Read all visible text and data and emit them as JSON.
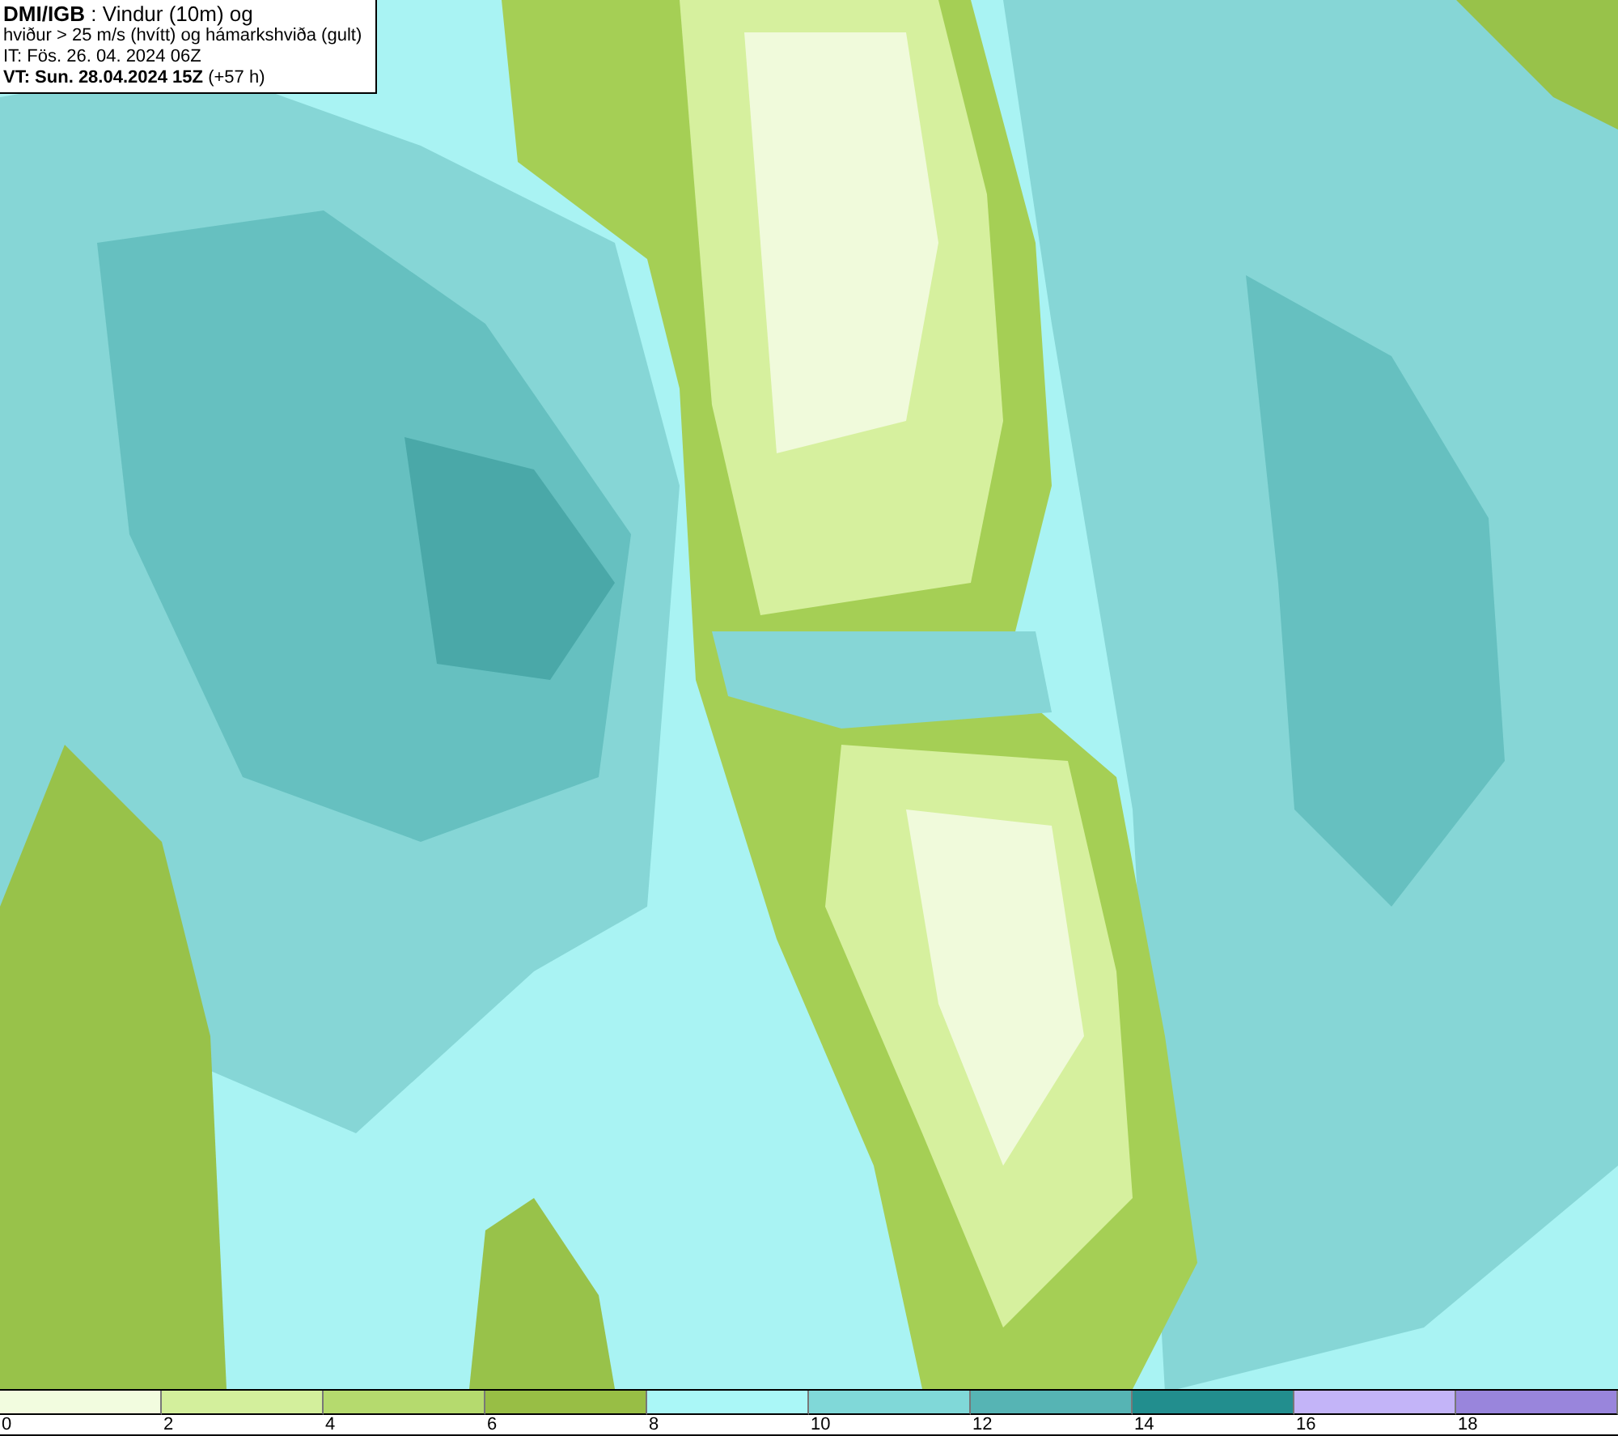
{
  "header": {
    "lines": [
      "**DMI/IGB** : Vindur (10m) og",
      "hviður > 25 m/s (hvítt) og hámarkshviða (gult)",
      "IT: Fös. 26. 04. 2024 06Z",
      "**VT: Sun. 28.04.2024 15Z** (+57 h)"
    ]
  },
  "legend": {
    "bins": [
      {
        "color": "#f2fcdf",
        "label": "0"
      },
      {
        "color": "#d3ef9c",
        "label": "2"
      },
      {
        "color": "#b5da6e",
        "label": "4"
      },
      {
        "color": "#98be45",
        "label": "6"
      },
      {
        "color": "#aaf7f7",
        "label": "8"
      },
      {
        "color": "#80d8d8",
        "label": "10"
      },
      {
        "color": "#56b4b4",
        "label": "12"
      },
      {
        "color": "#228e8e",
        "label": "14"
      },
      {
        "color": "#c3b4f8",
        "label": "16"
      },
      {
        "color": "#9985dc",
        "label": "18"
      }
    ]
  }
}
